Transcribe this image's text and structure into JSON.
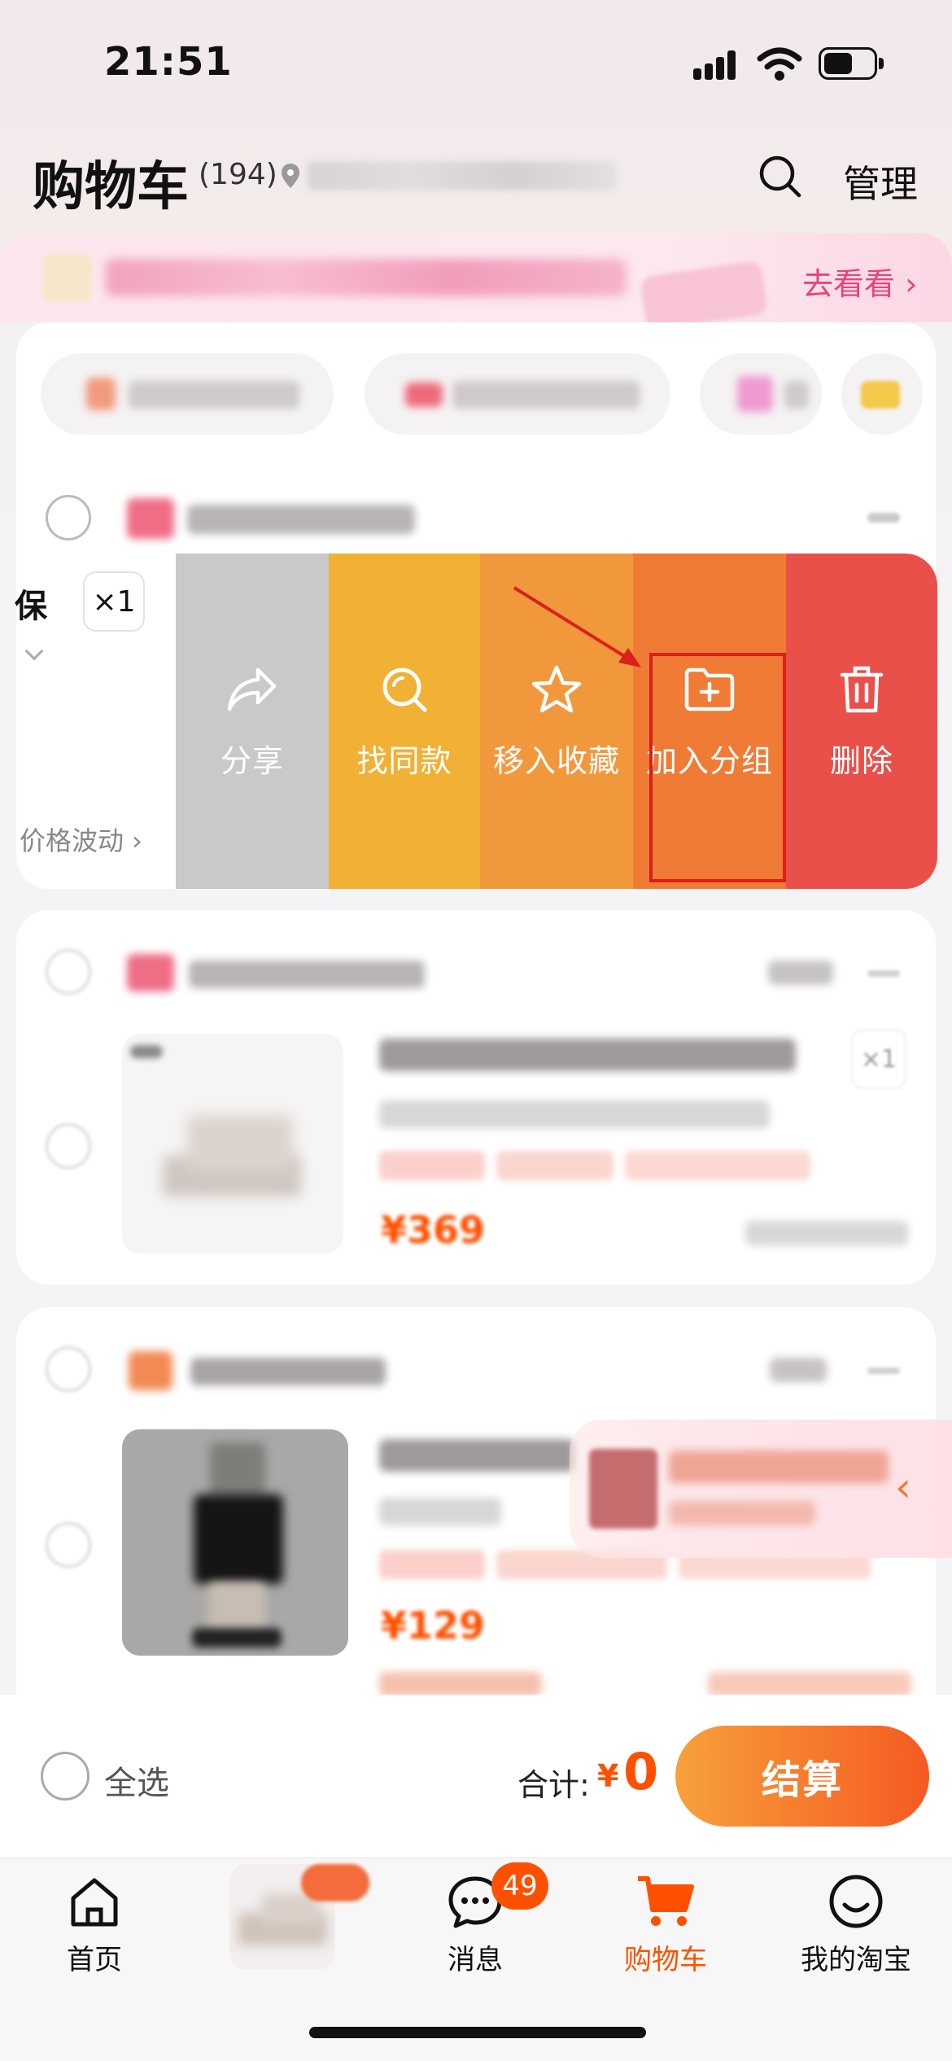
{
  "status_bar": {
    "time": "21:51"
  },
  "header": {
    "title": "购物车",
    "count": "(194)",
    "manage": "管理"
  },
  "promo_banner": {
    "cta": "去看看 ›"
  },
  "expanded_item": {
    "partial_title": "保",
    "quantity": "×1",
    "price_fluctuation": "价格波动 ›"
  },
  "actions": [
    {
      "label": "分享",
      "icon": "share-icon",
      "color": "#c9c9cc"
    },
    {
      "label": "找同款",
      "icon": "find-similar-icon",
      "color": "#f0b135"
    },
    {
      "label": "移入收藏",
      "icon": "star-icon",
      "color": "#f2983c"
    },
    {
      "label": "加入分组",
      "icon": "folder-plus-icon",
      "color": "#ef7b34"
    },
    {
      "label": "删除",
      "icon": "trash-icon",
      "color": "#e9504a"
    }
  ],
  "item2": {
    "quantity": "×1",
    "price": "¥369"
  },
  "item3": {
    "price": "¥129"
  },
  "floating_toast": {
    "close": "‹"
  },
  "checkout": {
    "select_all": "全选",
    "total_label": "合计:",
    "currency": "¥",
    "total": "0",
    "button": "结算"
  },
  "tabs": [
    {
      "label": "首页",
      "icon": "home-icon"
    },
    {
      "label": "",
      "icon": "product-thumbnail"
    },
    {
      "label": "消息",
      "icon": "message-icon",
      "badge": "49"
    },
    {
      "label": "购物车",
      "icon": "cart-icon",
      "active": true
    },
    {
      "label": "我的淘宝",
      "icon": "profile-icon"
    }
  ],
  "colors": {
    "accent": "#ff5000",
    "highlight_box": "#d9201b",
    "checkout_gradient": [
      "#f7a03c",
      "#f55a21"
    ]
  }
}
